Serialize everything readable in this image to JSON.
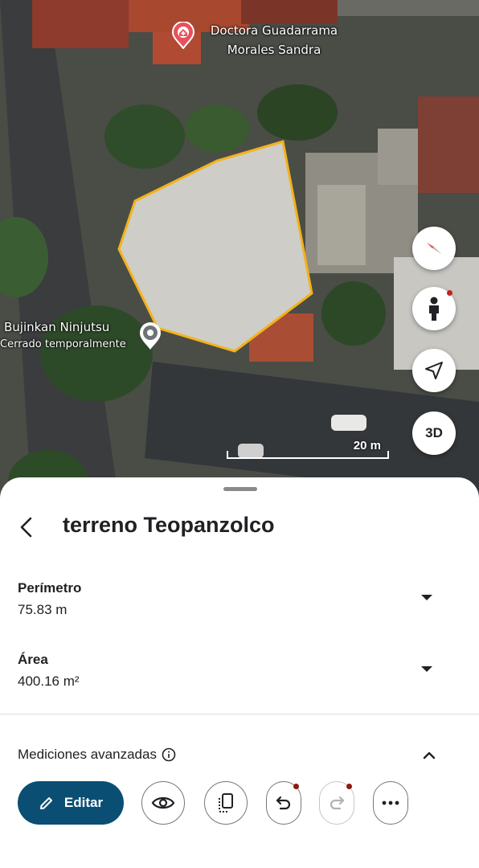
{
  "map": {
    "poi_doctor": {
      "line1": "Doctora Guadarrama",
      "line2": "Morales Sandra",
      "icon": "hospital-pin-icon"
    },
    "poi_bujinkan": {
      "name": "Bujinkan Ninjutsu",
      "status": "Cerrado temporalmente",
      "icon": "place-pin-icon"
    },
    "scale_label": "20 m",
    "controls": {
      "compass_icon": "compass-icon",
      "pegman_icon": "pegman-icon",
      "locate_icon": "my-location-arrow-icon",
      "three_d_label": "3D"
    },
    "polygon_color": "#f2b21b"
  },
  "sheet": {
    "title": "terreno Teopanzolco",
    "perimeter": {
      "label": "Perímetro",
      "value": "75.83 m"
    },
    "area": {
      "label": "Área",
      "value": "400.16 m²"
    },
    "advanced_label": "Mediciones avanzadas",
    "edit_label": "Editar",
    "tools": [
      "eye-icon",
      "copy-icon",
      "undo-icon",
      "redo-icon",
      "more-icon"
    ],
    "accent_color": "#0b4e74"
  }
}
